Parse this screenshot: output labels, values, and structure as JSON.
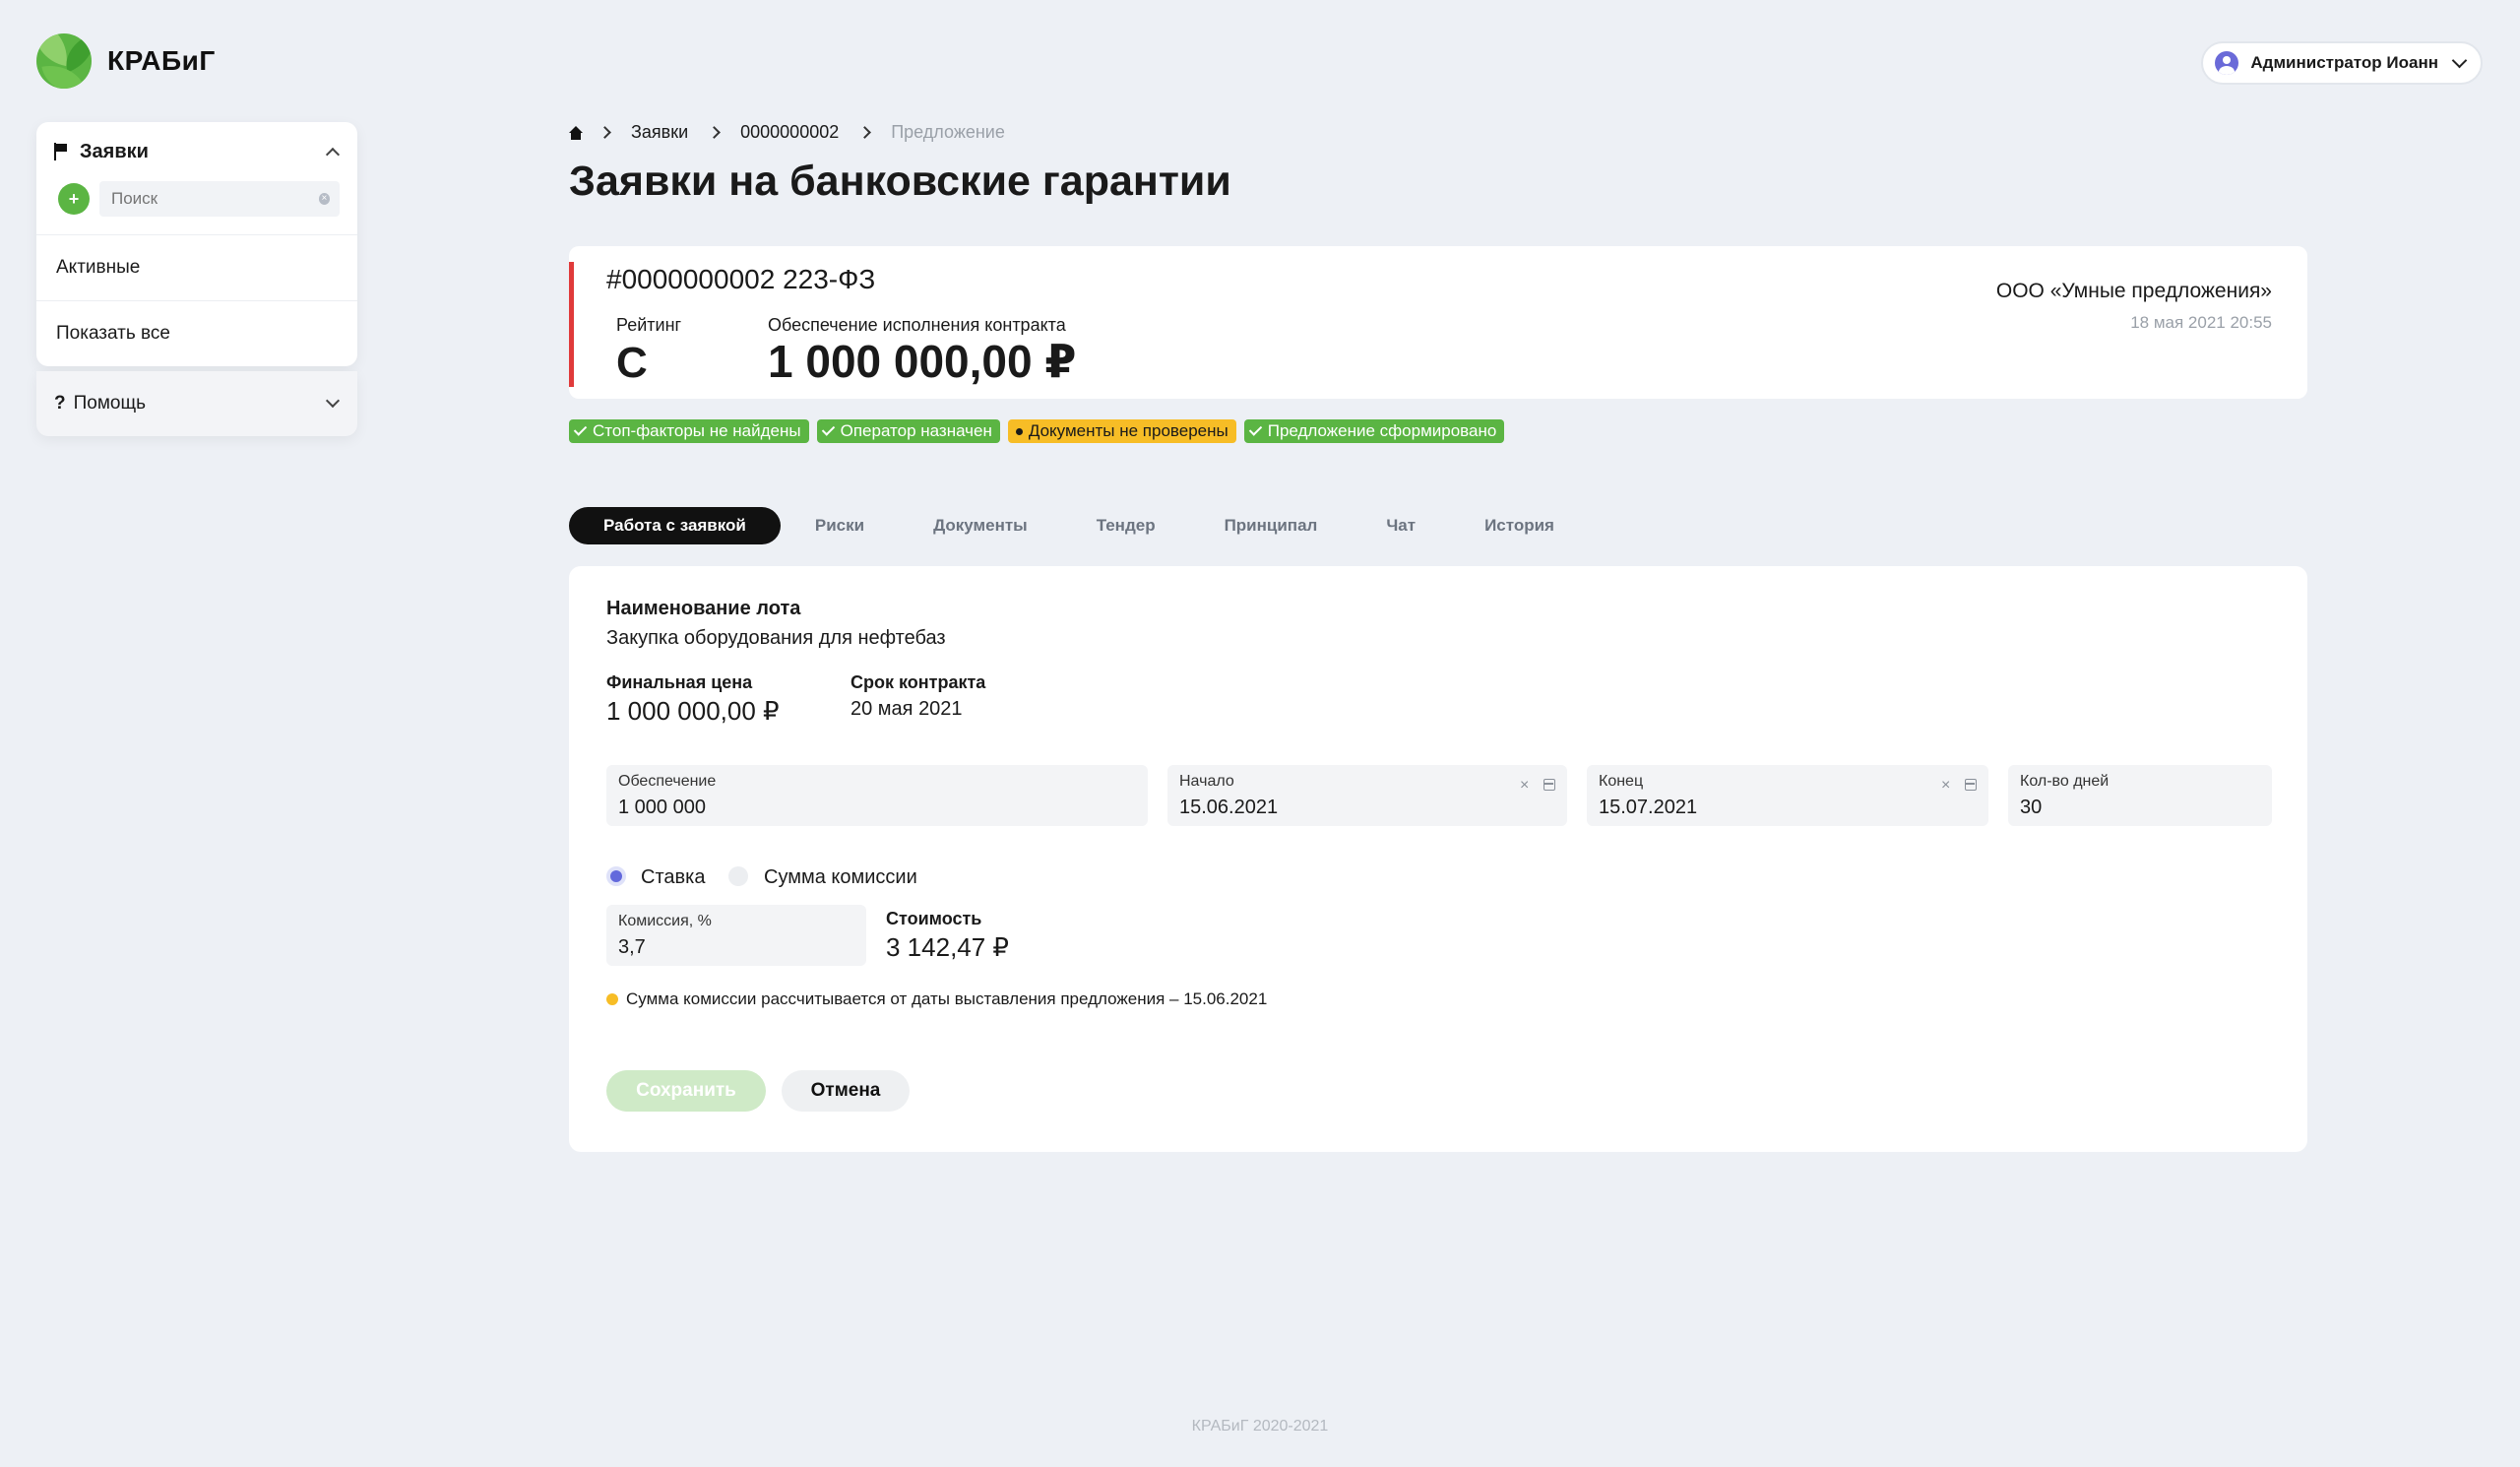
{
  "brand": {
    "name": "КРАБиГ"
  },
  "user": {
    "name": "Администратор Иоанн"
  },
  "sidebar": {
    "title": "Заявки",
    "search_placeholder": "Поиск",
    "items": [
      {
        "label": "Активные"
      },
      {
        "label": "Показать все"
      }
    ],
    "help": {
      "icon": "?",
      "label": "Помощь"
    }
  },
  "breadcrumb": {
    "items": [
      {
        "label": "Заявки"
      },
      {
        "label": "0000000002"
      },
      {
        "label": "Предложение"
      }
    ]
  },
  "page": {
    "title": "Заявки на банковские гарантии"
  },
  "application": {
    "number": "#0000000002 223-ФЗ",
    "rating_label": "Рейтинг",
    "rating_value": "C",
    "amount_label": "Обеспечение исполнения контракта",
    "amount_value": "1 000 000,00 ₽",
    "organization": "ООО «Умные предложения»",
    "date": "18 мая 2021 20:55",
    "accent_color": "#e03a3a"
  },
  "statuses": [
    {
      "label": "Стоп-факторы не найдены",
      "type": "success"
    },
    {
      "label": "Оператор назначен",
      "type": "success"
    },
    {
      "label": "Документы не проверены",
      "type": "warning"
    },
    {
      "label": "Предложение сформировано",
      "type": "success"
    }
  ],
  "tabs": [
    {
      "label": "Работа с заявкой",
      "active": true
    },
    {
      "label": "Риски"
    },
    {
      "label": "Документы"
    },
    {
      "label": "Тендер"
    },
    {
      "label": "Принципал"
    },
    {
      "label": "Чат"
    },
    {
      "label": "История"
    }
  ],
  "form": {
    "lot_label": "Наименование лота",
    "lot_value": "Закупка оборудования для нефтебаз",
    "final_price_label": "Финальная цена",
    "final_price_value": "1 000 000,00 ₽",
    "contract_term_label": "Срок контракта",
    "contract_term_value": "20 мая 2021",
    "security": {
      "label": "Обеспечение",
      "value": "1 000 000"
    },
    "start": {
      "label": "Начало",
      "value": "15.06.2021"
    },
    "end": {
      "label": "Конец",
      "value": "15.07.2021"
    },
    "days": {
      "label": "Кол-во дней",
      "value": "30"
    },
    "radio_rate": "Ставка",
    "radio_commission": "Сумма комиссии",
    "commission": {
      "label": "Комиссия, %",
      "value": "3,7"
    },
    "cost_label": "Стоимость",
    "cost_value": "3 142,47 ₽",
    "info": "Сумма комиссии рассчитывается от даты выставления предложения – 15.06.2021",
    "save_label": "Сохранить",
    "cancel_label": "Отмена"
  },
  "colors": {
    "brand_green": "#5bb543",
    "warning_yellow": "#f7bd26",
    "radio_accent": "#6369dc"
  },
  "footer": {
    "text": "КРАБиГ 2020-2021"
  }
}
